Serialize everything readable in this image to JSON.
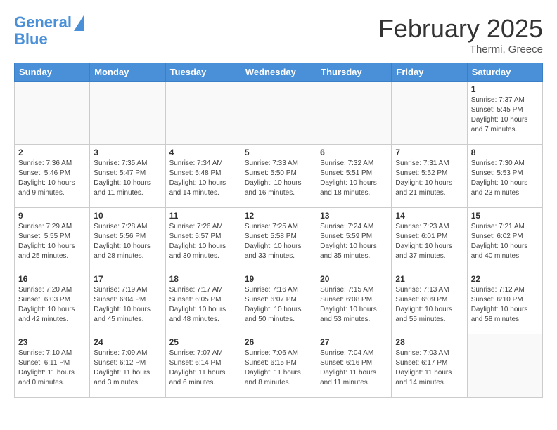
{
  "header": {
    "logo_line1": "General",
    "logo_line2": "Blue",
    "month": "February 2025",
    "location": "Thermi, Greece"
  },
  "weekdays": [
    "Sunday",
    "Monday",
    "Tuesday",
    "Wednesday",
    "Thursday",
    "Friday",
    "Saturday"
  ],
  "weeks": [
    [
      {
        "day": "",
        "info": ""
      },
      {
        "day": "",
        "info": ""
      },
      {
        "day": "",
        "info": ""
      },
      {
        "day": "",
        "info": ""
      },
      {
        "day": "",
        "info": ""
      },
      {
        "day": "",
        "info": ""
      },
      {
        "day": "1",
        "info": "Sunrise: 7:37 AM\nSunset: 5:45 PM\nDaylight: 10 hours\nand 7 minutes."
      }
    ],
    [
      {
        "day": "2",
        "info": "Sunrise: 7:36 AM\nSunset: 5:46 PM\nDaylight: 10 hours\nand 9 minutes."
      },
      {
        "day": "3",
        "info": "Sunrise: 7:35 AM\nSunset: 5:47 PM\nDaylight: 10 hours\nand 11 minutes."
      },
      {
        "day": "4",
        "info": "Sunrise: 7:34 AM\nSunset: 5:48 PM\nDaylight: 10 hours\nand 14 minutes."
      },
      {
        "day": "5",
        "info": "Sunrise: 7:33 AM\nSunset: 5:50 PM\nDaylight: 10 hours\nand 16 minutes."
      },
      {
        "day": "6",
        "info": "Sunrise: 7:32 AM\nSunset: 5:51 PM\nDaylight: 10 hours\nand 18 minutes."
      },
      {
        "day": "7",
        "info": "Sunrise: 7:31 AM\nSunset: 5:52 PM\nDaylight: 10 hours\nand 21 minutes."
      },
      {
        "day": "8",
        "info": "Sunrise: 7:30 AM\nSunset: 5:53 PM\nDaylight: 10 hours\nand 23 minutes."
      }
    ],
    [
      {
        "day": "9",
        "info": "Sunrise: 7:29 AM\nSunset: 5:55 PM\nDaylight: 10 hours\nand 25 minutes."
      },
      {
        "day": "10",
        "info": "Sunrise: 7:28 AM\nSunset: 5:56 PM\nDaylight: 10 hours\nand 28 minutes."
      },
      {
        "day": "11",
        "info": "Sunrise: 7:26 AM\nSunset: 5:57 PM\nDaylight: 10 hours\nand 30 minutes."
      },
      {
        "day": "12",
        "info": "Sunrise: 7:25 AM\nSunset: 5:58 PM\nDaylight: 10 hours\nand 33 minutes."
      },
      {
        "day": "13",
        "info": "Sunrise: 7:24 AM\nSunset: 5:59 PM\nDaylight: 10 hours\nand 35 minutes."
      },
      {
        "day": "14",
        "info": "Sunrise: 7:23 AM\nSunset: 6:01 PM\nDaylight: 10 hours\nand 37 minutes."
      },
      {
        "day": "15",
        "info": "Sunrise: 7:21 AM\nSunset: 6:02 PM\nDaylight: 10 hours\nand 40 minutes."
      }
    ],
    [
      {
        "day": "16",
        "info": "Sunrise: 7:20 AM\nSunset: 6:03 PM\nDaylight: 10 hours\nand 42 minutes."
      },
      {
        "day": "17",
        "info": "Sunrise: 7:19 AM\nSunset: 6:04 PM\nDaylight: 10 hours\nand 45 minutes."
      },
      {
        "day": "18",
        "info": "Sunrise: 7:17 AM\nSunset: 6:05 PM\nDaylight: 10 hours\nand 48 minutes."
      },
      {
        "day": "19",
        "info": "Sunrise: 7:16 AM\nSunset: 6:07 PM\nDaylight: 10 hours\nand 50 minutes."
      },
      {
        "day": "20",
        "info": "Sunrise: 7:15 AM\nSunset: 6:08 PM\nDaylight: 10 hours\nand 53 minutes."
      },
      {
        "day": "21",
        "info": "Sunrise: 7:13 AM\nSunset: 6:09 PM\nDaylight: 10 hours\nand 55 minutes."
      },
      {
        "day": "22",
        "info": "Sunrise: 7:12 AM\nSunset: 6:10 PM\nDaylight: 10 hours\nand 58 minutes."
      }
    ],
    [
      {
        "day": "23",
        "info": "Sunrise: 7:10 AM\nSunset: 6:11 PM\nDaylight: 11 hours\nand 0 minutes."
      },
      {
        "day": "24",
        "info": "Sunrise: 7:09 AM\nSunset: 6:12 PM\nDaylight: 11 hours\nand 3 minutes."
      },
      {
        "day": "25",
        "info": "Sunrise: 7:07 AM\nSunset: 6:14 PM\nDaylight: 11 hours\nand 6 minutes."
      },
      {
        "day": "26",
        "info": "Sunrise: 7:06 AM\nSunset: 6:15 PM\nDaylight: 11 hours\nand 8 minutes."
      },
      {
        "day": "27",
        "info": "Sunrise: 7:04 AM\nSunset: 6:16 PM\nDaylight: 11 hours\nand 11 minutes."
      },
      {
        "day": "28",
        "info": "Sunrise: 7:03 AM\nSunset: 6:17 PM\nDaylight: 11 hours\nand 14 minutes."
      },
      {
        "day": "",
        "info": ""
      }
    ]
  ]
}
